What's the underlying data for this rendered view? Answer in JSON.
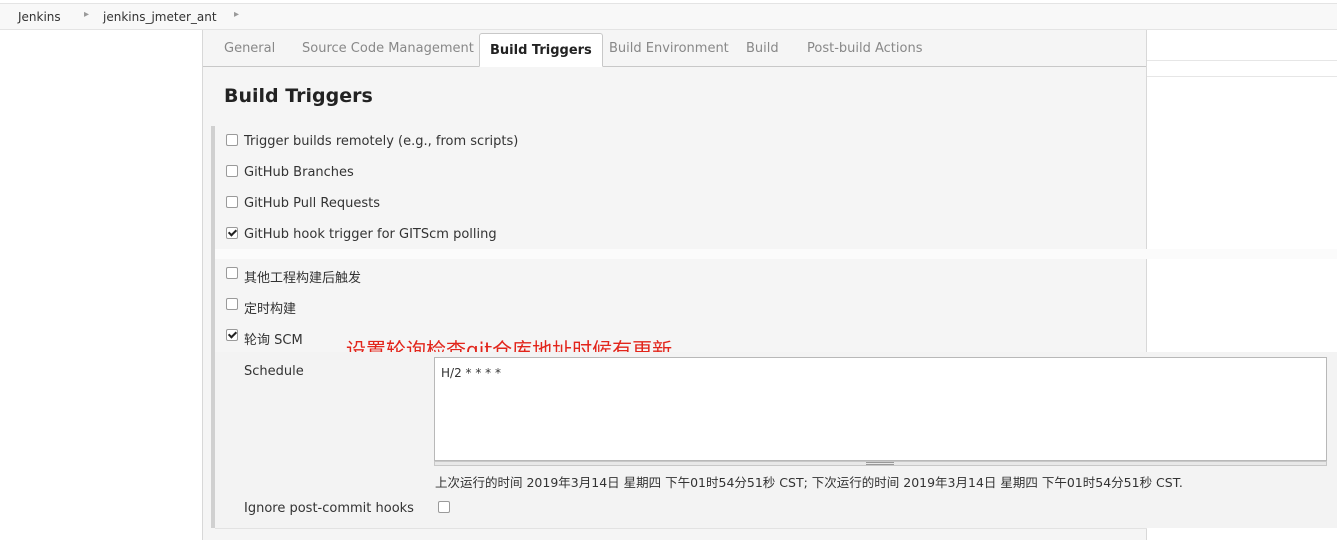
{
  "breadcrumb": {
    "items": [
      "Jenkins",
      "jenkins_jmeter_ant"
    ],
    "separator": "▸"
  },
  "tabs": [
    {
      "label": "General",
      "active": false
    },
    {
      "label": "Source Code Management",
      "active": false
    },
    {
      "label": "Build Triggers",
      "active": true
    },
    {
      "label": "Build Environment",
      "active": false
    },
    {
      "label": "Build",
      "active": false
    },
    {
      "label": "Post-build Actions",
      "active": false
    }
  ],
  "section": {
    "title": "Build Triggers"
  },
  "triggers": [
    {
      "label": "Trigger builds remotely (e.g., from scripts)",
      "checked": false
    },
    {
      "label": "GitHub Branches",
      "checked": false
    },
    {
      "label": "GitHub Pull Requests",
      "checked": false
    },
    {
      "label": "GitHub hook trigger for GITScm polling",
      "checked": true
    },
    {
      "label": "其他工程构建后触发",
      "checked": false
    },
    {
      "label": "定时构建",
      "checked": false
    },
    {
      "label": "轮询 SCM",
      "checked": true
    }
  ],
  "annotation": "设置轮询检查git仓库地址时候有更新",
  "schedule": {
    "label": "Schedule",
    "value": "H/2 * * * *",
    "info": "上次运行的时间 2019年3月14日 星期四 下午01时54分51秒 CST; 下次运行的时间 2019年3月14日 星期四 下午01时54分51秒 CST."
  },
  "ignore_post_commit": {
    "label": "Ignore post-commit hooks",
    "checked": false
  },
  "colors": {
    "annotation": "#e2251b",
    "panel_bg": "#f5f5f5",
    "tab_border": "#c8c8c8"
  }
}
